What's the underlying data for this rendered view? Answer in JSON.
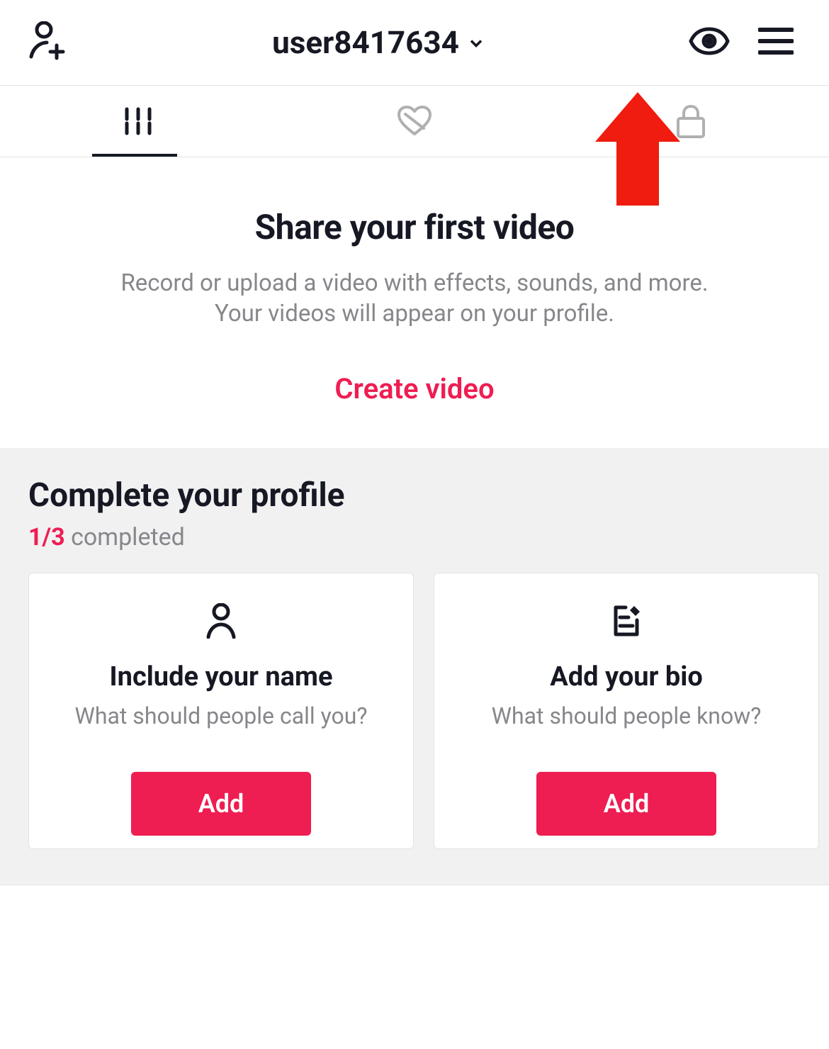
{
  "header": {
    "username": "user8417634"
  },
  "empty": {
    "title": "Share your first video",
    "subtitle1": "Record or upload a video with effects, sounds, and more.",
    "subtitle2": "Your videos will appear on your profile.",
    "cta": "Create video"
  },
  "complete": {
    "title": "Complete your profile",
    "progress_num": "1/3",
    "progress_label": " completed"
  },
  "cards": [
    {
      "title": "Include your name",
      "subtitle": "What should people call you?",
      "button": "Add"
    },
    {
      "title": "Add your bio",
      "subtitle": "What should people know?",
      "button": "Add"
    }
  ]
}
